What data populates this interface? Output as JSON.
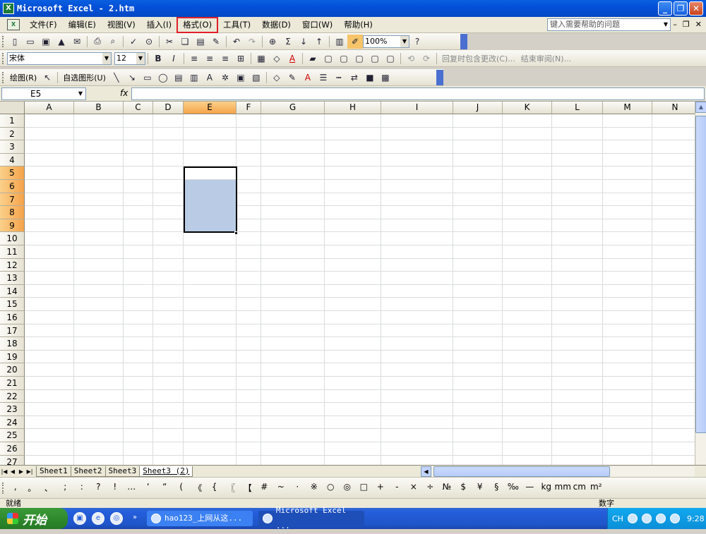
{
  "window": {
    "title": "Microsoft Excel - 2.htm"
  },
  "menubar": {
    "items": [
      "文件(F)",
      "编辑(E)",
      "视图(V)",
      "插入(I)",
      "格式(O)",
      "工具(T)",
      "数据(D)",
      "窗口(W)",
      "帮助(H)"
    ],
    "highlighted_index": 4,
    "help_placeholder": "键入需要帮助的问题"
  },
  "standard_toolbar": {
    "zoom": "100%"
  },
  "formatting_toolbar": {
    "font": "宋体",
    "size": "12",
    "review_reply": "回复时包含更改(C)...",
    "review_end": "结束审阅(N)..."
  },
  "drawing_toolbar": {
    "draw_label": "绘图(R)",
    "autoshapes_label": "自选图形(U)"
  },
  "formula_bar": {
    "name_box": "E5",
    "fx": "fx",
    "formula": ""
  },
  "grid": {
    "columns": [
      "A",
      "B",
      "C",
      "D",
      "E",
      "F",
      "G",
      "H",
      "I",
      "J",
      "K",
      "L",
      "M",
      "N"
    ],
    "rows": [
      "1",
      "2",
      "3",
      "4",
      "5",
      "6",
      "7",
      "8",
      "9",
      "10",
      "11",
      "12",
      "13",
      "14",
      "15",
      "16",
      "17",
      "18",
      "19",
      "20",
      "21",
      "22",
      "23",
      "24",
      "25",
      "26",
      "27"
    ],
    "selected_column": "E",
    "selected_rows": [
      "5",
      "6",
      "7",
      "8",
      "9"
    ],
    "active_cell": "E5"
  },
  "sheet_tabs": [
    "Sheet1",
    "Sheet2",
    "Sheet3",
    "Sheet3 (2)"
  ],
  "active_sheet": "Sheet3 (2)",
  "symbol_bar": [
    ",",
    "。",
    "、",
    ";",
    ":",
    "?",
    "!",
    "…",
    "‘",
    "“",
    "(",
    "《",
    "{",
    "〖",
    "【",
    "#",
    "~",
    "·",
    "※",
    "○",
    "◎",
    "□",
    "+",
    "-",
    "×",
    "÷",
    "№",
    "$",
    "¥",
    "§",
    "‰",
    "—",
    "kg",
    "mm",
    "cm",
    "m²"
  ],
  "status": {
    "left": "就绪",
    "right": "数字"
  },
  "taskbar": {
    "start": "开始",
    "tasks": [
      "hao123_上网从这...",
      "Microsoft Excel ..."
    ],
    "clock": "9:28",
    "lang": "CH"
  }
}
